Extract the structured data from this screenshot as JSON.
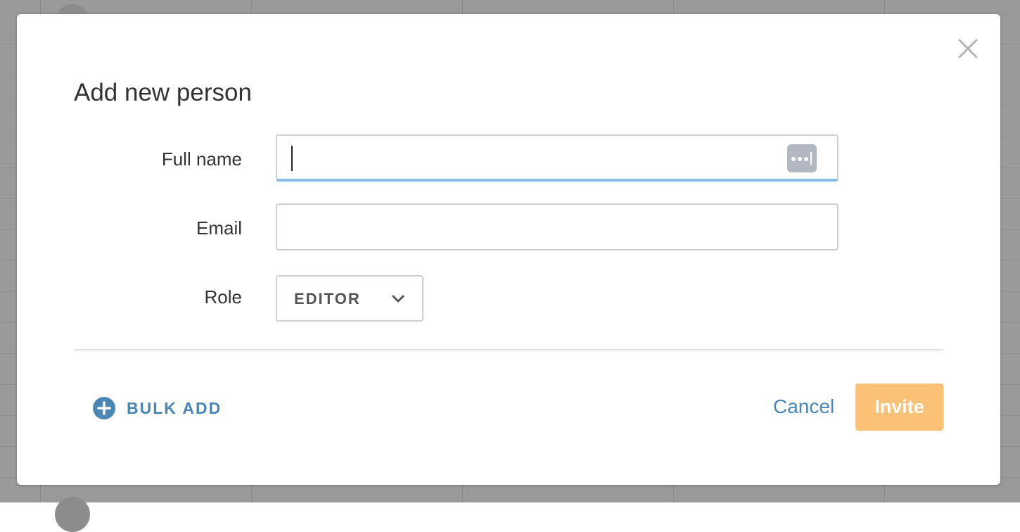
{
  "dialog": {
    "title": "Add new person",
    "close_icon": "close-icon"
  },
  "form": {
    "full_name": {
      "label": "Full name",
      "value": "",
      "focused": true,
      "autofill_icon": "password-autofill-icon"
    },
    "email": {
      "label": "Email",
      "value": ""
    },
    "role": {
      "label": "Role",
      "selected": "EDITOR",
      "icon": "chevron-down-icon"
    }
  },
  "footer": {
    "bulk_add_label": "BULK ADD",
    "bulk_add_icon": "plus-circle-icon",
    "cancel_label": "Cancel",
    "invite_label": "Invite"
  },
  "colors": {
    "accent": "#4a86b4",
    "invite_button": "#fbc176",
    "focus_underline": "#86bde6",
    "overlay": "#9a9a9a"
  }
}
